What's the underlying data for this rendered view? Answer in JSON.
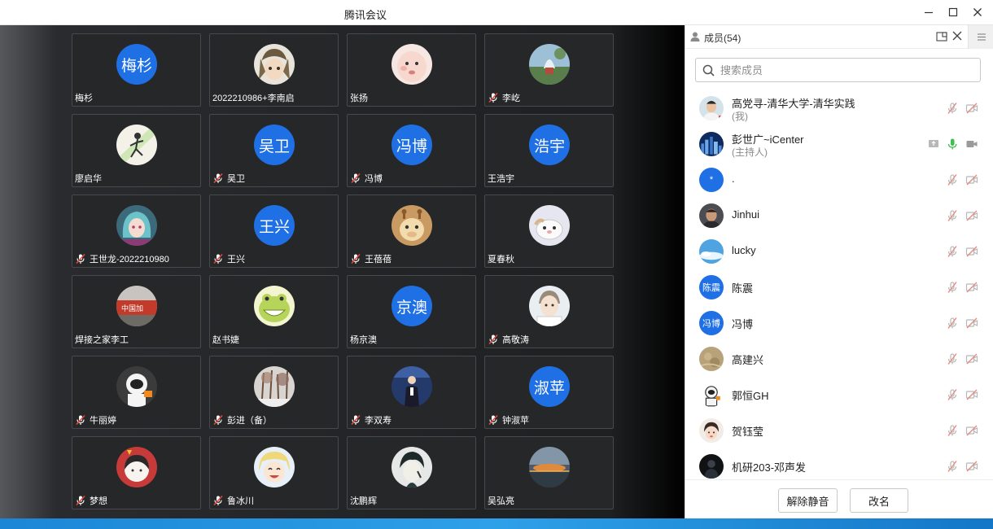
{
  "window": {
    "title": "腾讯会议"
  },
  "grid": [
    {
      "name": "梅杉",
      "avatar_text": "梅杉",
      "muted": false,
      "avatar": "text"
    },
    {
      "name": "2022210986+李南启",
      "muted": false,
      "avatar": "anime-face"
    },
    {
      "name": "张扬",
      "muted": false,
      "avatar": "baby-face"
    },
    {
      "name": "李屹",
      "muted": true,
      "avatar": "fountain"
    },
    {
      "name": "廖启华",
      "muted": false,
      "avatar": "runner-art"
    },
    {
      "name": "吴卫",
      "avatar_text": "吴卫",
      "muted": true,
      "avatar": "text"
    },
    {
      "name": "冯博",
      "avatar_text": "冯博",
      "muted": true,
      "avatar": "text"
    },
    {
      "name": "王浩宇",
      "avatar_text": "浩宇",
      "muted": false,
      "avatar": "text"
    },
    {
      "name": "王世龙-2022210980",
      "muted": true,
      "avatar": "anime-girl"
    },
    {
      "name": "王兴",
      "avatar_text": "王兴",
      "muted": true,
      "avatar": "text"
    },
    {
      "name": "王蓓蓓",
      "muted": true,
      "avatar": "giraffe"
    },
    {
      "name": "夏春秋",
      "muted": false,
      "avatar": "hamster"
    },
    {
      "name": "焊接之家李工",
      "muted": false,
      "avatar": "storefront"
    },
    {
      "name": "赵书婕",
      "muted": false,
      "avatar": "frog"
    },
    {
      "name": "杨京澳",
      "avatar_text": "京澳",
      "muted": false,
      "avatar": "text"
    },
    {
      "name": "高敬涛",
      "muted": true,
      "avatar": "cartoon-man"
    },
    {
      "name": "牛丽婷",
      "muted": true,
      "avatar": "astronaut"
    },
    {
      "name": "彭进（备）",
      "muted": true,
      "avatar": "winter-trees"
    },
    {
      "name": "李双寿",
      "muted": true,
      "avatar": "speaker"
    },
    {
      "name": "钟淑苹",
      "avatar_text": "淑苹",
      "muted": true,
      "avatar": "text"
    },
    {
      "name": "梦想",
      "muted": true,
      "avatar": "red-girl"
    },
    {
      "name": "鲁冰川",
      "muted": true,
      "avatar": "anime-smile"
    },
    {
      "name": "沈鹏辉",
      "muted": false,
      "avatar": "sketch-boy"
    },
    {
      "name": "吴弘亮",
      "muted": false,
      "avatar": "sunset"
    }
  ],
  "panel": {
    "title": "成员(54)",
    "search_placeholder": "搜索成员",
    "members": [
      {
        "name": "高党寻-清华大学-清华实践",
        "role": "(我)",
        "avatar": "photo-man",
        "mic": "muted",
        "video": "off"
      },
      {
        "name": "彭世广~iCenter",
        "role": "(主持人)",
        "avatar": "city-night",
        "mic": "on",
        "video": "on-gray",
        "share": true
      },
      {
        "name": ".",
        "avatar": "text",
        "avatar_text": "*",
        "mic": "muted",
        "video": "off"
      },
      {
        "name": "Jinhui",
        "avatar": "photo-man2",
        "mic": "muted",
        "video": "off"
      },
      {
        "name": "lucky",
        "avatar": "sky",
        "mic": "muted",
        "video": "off"
      },
      {
        "name": "陈震",
        "avatar": "text",
        "avatar_text": "陈震",
        "mic": "muted",
        "video": "off"
      },
      {
        "name": "冯博",
        "avatar": "text",
        "avatar_text": "冯博",
        "mic": "muted",
        "video": "off"
      },
      {
        "name": "高建兴",
        "avatar": "sand",
        "mic": "muted",
        "video": "off"
      },
      {
        "name": "郭恒GH",
        "avatar": "astronaut-small",
        "mic": "muted",
        "video": "off"
      },
      {
        "name": "贺钰莹",
        "avatar": "child",
        "mic": "muted",
        "video": "off"
      },
      {
        "name": "机研203-邓声发",
        "avatar": "dark-figure",
        "mic": "muted",
        "video": "off"
      }
    ],
    "buttons": {
      "unmute": "解除静音",
      "rename": "改名"
    }
  },
  "colors": {
    "accent": "#1f6fe5",
    "muted_mic": "#d9534f",
    "mic_on": "#3bbf4f"
  }
}
